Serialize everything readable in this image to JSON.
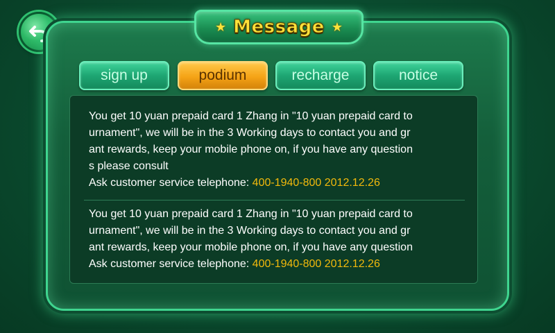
{
  "header": {
    "title": "Message"
  },
  "tabs": [
    {
      "label": "sign up",
      "active": false
    },
    {
      "label": "podium",
      "active": true
    },
    {
      "label": "recharge",
      "active": false
    },
    {
      "label": "notice",
      "active": false
    }
  ],
  "messages": [
    {
      "lines": [
        "You get 10 yuan prepaid card 1 Zhang in \"10 yuan prepaid card to",
        "urnament\", we will be in the 3  Working days to contact you and gr",
        "ant rewards, keep your mobile phone on, if you have any question",
        "s please consult"
      ],
      "contact_label": "Ask customer service telephone: ",
      "phone": "400-1940-800",
      "date": "2012.12.26"
    },
    {
      "lines": [
        "You get 10 yuan prepaid card 1 Zhang in \"10 yuan prepaid card to",
        "urnament\", we will be in the 3  Working days to contact you and gr",
        "ant rewards, keep your mobile phone on, if you have any question"
      ],
      "contact_label": "Ask customer service telephone: ",
      "phone": "400-1940-800",
      "date": "2012.12.26"
    }
  ],
  "icons": {
    "back": "back-arrow-icon",
    "title_stars": "star-icon"
  },
  "colors": {
    "highlight": "#f2b90c",
    "title": "#ffe23a",
    "active_tab": "#f5a316",
    "tab": "#1ea673"
  }
}
